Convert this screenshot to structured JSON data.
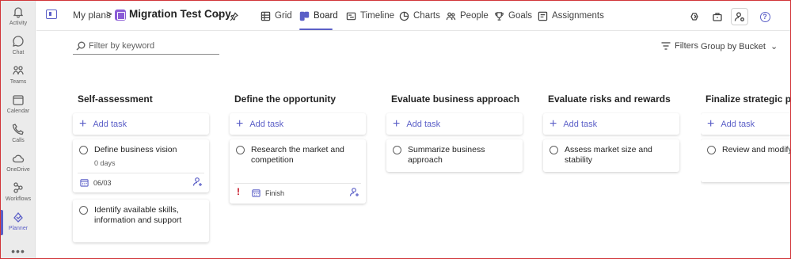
{
  "rail": {
    "items": [
      {
        "label": "Activity",
        "icon": "bell-icon"
      },
      {
        "label": "Chat",
        "icon": "chat-icon"
      },
      {
        "label": "Teams",
        "icon": "teams-icon"
      },
      {
        "label": "Calendar",
        "icon": "calendar-icon"
      },
      {
        "label": "Calls",
        "icon": "phone-icon"
      },
      {
        "label": "OneDrive",
        "icon": "cloud-icon"
      },
      {
        "label": "Workflows",
        "icon": "workflows-icon"
      },
      {
        "label": "Planner",
        "icon": "planner-icon"
      }
    ],
    "more": "•••"
  },
  "header": {
    "breadcrumb": "My plans",
    "breadcrumb_sep": ">",
    "plan_title": "Migration Test Copy",
    "tabs": [
      {
        "label": "Grid"
      },
      {
        "label": "Board"
      },
      {
        "label": "Timeline"
      },
      {
        "label": "Charts"
      },
      {
        "label": "People"
      },
      {
        "label": "Goals"
      },
      {
        "label": "Assignments"
      }
    ],
    "active_tab": "Board",
    "accent": "#5b5fc7"
  },
  "toolbar": {
    "filter_placeholder": "Filter by keyword",
    "filters_label": "Filters",
    "group_by_label": "Group by Bucket"
  },
  "board": {
    "add_task_label": "Add task",
    "buckets": [
      {
        "title": "Self-assessment",
        "tasks": [
          {
            "title": "Define business vision",
            "progress_text": "0 days",
            "due": "06/03"
          },
          {
            "title": "Identify available skills, information and support"
          }
        ]
      },
      {
        "title": "Define the opportunity",
        "tasks": [
          {
            "title": "Research the market and competition",
            "priority": "!",
            "due": "Finish"
          }
        ]
      },
      {
        "title": "Evaluate business approach",
        "tasks": [
          {
            "title": "Summarize business approach"
          }
        ]
      },
      {
        "title": "Evaluate risks and rewards",
        "tasks": [
          {
            "title": "Assess market size and stability"
          }
        ]
      },
      {
        "title": "Finalize strategic plan",
        "tasks": [
          {
            "title": "Review and modify the plan"
          }
        ]
      }
    ]
  }
}
